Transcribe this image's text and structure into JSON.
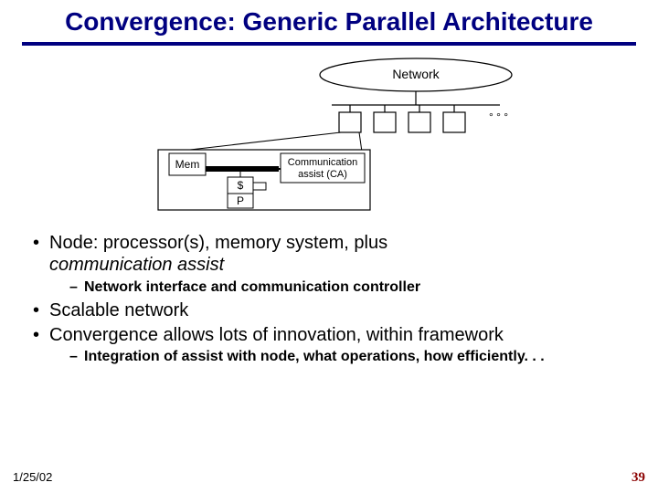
{
  "title": "Convergence: Generic Parallel Architecture",
  "diagram": {
    "network_label": "Network",
    "mem_label": "Mem",
    "ca_label_line1": "Communication",
    "ca_label_line2": "assist (CA)",
    "cache_label": "$",
    "proc_label": "P",
    "ellipsis": "° ° °"
  },
  "bullets": {
    "b1": {
      "text_a": "Node: processor(s), memory system, plus ",
      "text_b": "communication assist"
    },
    "b1_sub": "Network interface and communication controller",
    "b2": "Scalable network",
    "b3": "Convergence allows lots of innovation, within framework",
    "b3_sub": "Integration of assist with node, what operations, how efficiently. . ."
  },
  "footer": {
    "date": "1/25/02",
    "page": "39"
  }
}
